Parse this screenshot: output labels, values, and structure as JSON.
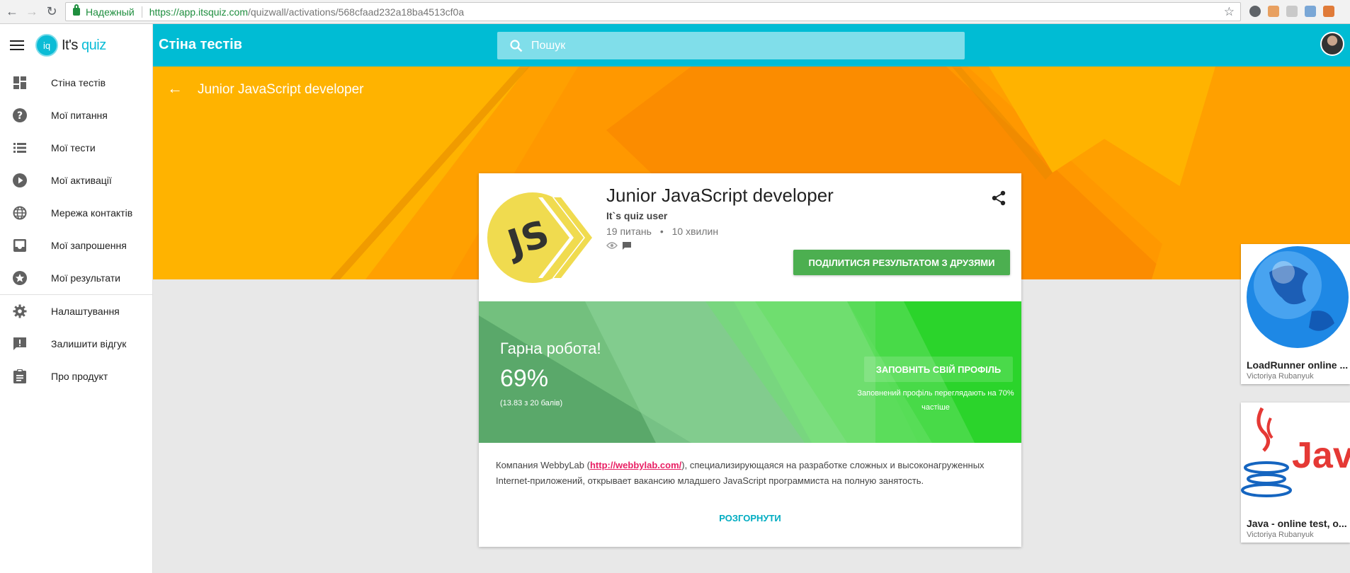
{
  "browser": {
    "secure_label": "Надежный",
    "url_host": "https://app.itsquiz.com",
    "url_path": "/quizwall/activations/568cfaad232a18ba4513cf0a"
  },
  "sidebar": {
    "logo_prefix": "It's",
    "logo_suffix": "quiz",
    "logo_mark": "iq",
    "items": [
      {
        "label": "Стіна тестів",
        "icon": "dashboard-icon"
      },
      {
        "label": "Мої питання",
        "icon": "help-icon"
      },
      {
        "label": "Мої тести",
        "icon": "list-icon"
      },
      {
        "label": "Мої активації",
        "icon": "play-icon"
      },
      {
        "label": "Мережа контактів",
        "icon": "globe-icon"
      },
      {
        "label": "Мої запрошення",
        "icon": "inbox-icon"
      },
      {
        "label": "Мої результати",
        "icon": "star-icon"
      },
      {
        "label": "Налаштування",
        "icon": "gear-icon"
      },
      {
        "label": "Залишити відгук",
        "icon": "feedback-icon"
      },
      {
        "label": "Про продукт",
        "icon": "clipboard-icon"
      }
    ]
  },
  "appbar": {
    "title": "Стіна тестів",
    "search_placeholder": "Пошук"
  },
  "hero": {
    "title": "Junior JavaScript developer"
  },
  "quiz": {
    "title": "Junior JavaScript developer",
    "author": "It`s quiz user",
    "questions": "19 питань",
    "duration": "10 хвилин",
    "share_button": "ПОДІЛИТИСЯ РЕЗУЛЬТАТОМ З ДРУЗЯМИ",
    "logo_text": "JS"
  },
  "result": {
    "headline": "Гарна робота!",
    "percent": "69%",
    "points": "(13.83 з 20 балів)",
    "profile_button": "ЗАПОВНІТЬ СВІЙ ПРОФІЛЬ",
    "profile_note": "Заповнений профіль переглядають на 70% частіше"
  },
  "description": {
    "before_link": "Компания WebbyLab (",
    "link": "http://webbylab.com/",
    "after_link": "), специализирующаяся на разработке сложных и высоконагруженных Internet-приложений, открывает вакансию младшего JavaScript программиста на полную занятость.",
    "expand_label": "РОЗГОРНУТИ"
  },
  "suggestions": [
    {
      "title": "LoadRunner online ...",
      "author": "Victoriya Rubanyuk"
    },
    {
      "title": "Java - online test, o...",
      "author": "Victoriya Rubanyuk",
      "image_text": "Jav"
    }
  ],
  "colors": {
    "appbar": "#00bcd4",
    "hero_orange": "#ffb300",
    "share_green": "#4caf50",
    "result_green": "#2bd42b",
    "link_pink": "#e91e63",
    "expand_cyan": "#00acc1"
  }
}
